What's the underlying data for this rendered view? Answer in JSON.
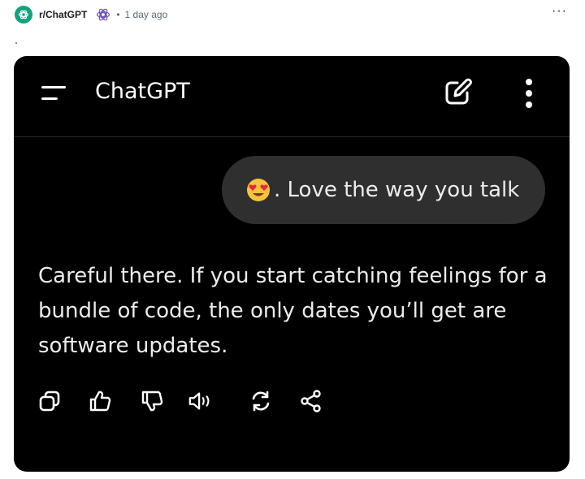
{
  "post": {
    "subreddit": "r/ChatGPT",
    "separator": "•",
    "time": "1 day ago",
    "overflow": "···"
  },
  "app": {
    "title": "ChatGPT"
  },
  "conversation": {
    "user_message": ". Love the way you talk",
    "emoji": "smiling-face-with-heart-eyes",
    "assistant_message": "Careful there. If you start catching feelings for a bundle of code, the only dates you’ll get are software updates."
  },
  "actions": [
    "copy-icon",
    "thumbs-up-icon",
    "thumbs-down-icon",
    "read-aloud-icon",
    "regenerate-icon",
    "share-icon"
  ],
  "colors": {
    "subreddit_accent": "#10a37f",
    "app_background": "#000000",
    "user_bubble": "#2f2f2f",
    "text": "#ececec"
  }
}
